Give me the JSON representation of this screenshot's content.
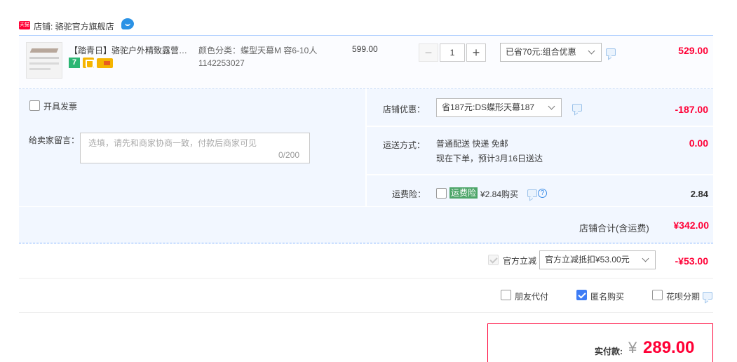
{
  "shop": {
    "badge": "天猫",
    "label": "店铺: 骆驼官方旗舰店",
    "chat_icon": "wangwang-chat-icon"
  },
  "item": {
    "title": "【踏青日】骆驼户外精致露营蝶形天幕",
    "sku": "颜色分类：蝶型天幕M 容6-10人",
    "code": "1142253027",
    "unit_price": "599.00",
    "quantity": "1",
    "qty_minus": "−",
    "qty_plus": "+",
    "promo_select": "已省70元:组合优惠",
    "total": "529.00",
    "service_badges": [
      "seven-day-return-icon",
      "guarantee-icon",
      "card-icon"
    ]
  },
  "invoice": {
    "label": "开具发票",
    "checked": false
  },
  "memo": {
    "label": "给卖家留言：",
    "placeholder": "选填，请先和商家协商一致，付款后商家可见",
    "count": "0/200"
  },
  "shop_discount": {
    "label": "店铺优惠：",
    "select": "省187元:DS蝶形天幕187",
    "amount": "-187.00"
  },
  "shipping": {
    "label": "运送方式：",
    "method": "普通配送 快递 免邮",
    "eta": "现在下单，预计3月16日送达",
    "amount": "0.00"
  },
  "insurance": {
    "label": "运费险：",
    "tag": "运费险",
    "price_text": "¥2.84购买",
    "amount": "2.84",
    "checked": false
  },
  "shop_total": {
    "label": "店铺合计(含运费)",
    "amount": "¥342.00"
  },
  "official_discount": {
    "label": "官方立减",
    "select": "官方立减抵扣¥53.00元",
    "amount": "-¥53.00",
    "checked": true
  },
  "options": {
    "friend_pay": {
      "label": "朋友代付",
      "checked": false
    },
    "anonymous": {
      "label": "匿名购买",
      "checked": true
    },
    "huabei": {
      "label": "花呗分期",
      "checked": false
    }
  },
  "payment": {
    "label": "实付款:",
    "currency": "¥",
    "amount": "289.00"
  },
  "colors": {
    "accent_red": "#ff0036",
    "panel_bg": "#f2f7ff",
    "checkbox_blue": "#3d7cf5"
  }
}
